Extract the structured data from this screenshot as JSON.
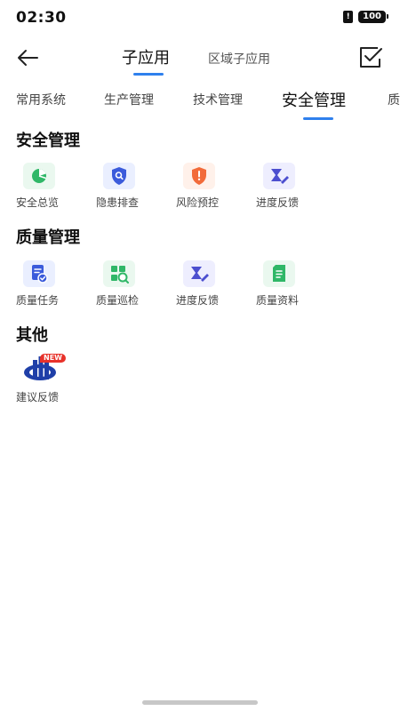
{
  "status_bar": {
    "time": "02:30",
    "sim": "!",
    "battery": "100"
  },
  "nav": {
    "tabs": [
      {
        "label": "子应用",
        "active": true
      },
      {
        "label": "区域子应用",
        "active": false
      }
    ]
  },
  "categories": [
    {
      "label": "常用系统",
      "active": false
    },
    {
      "label": "生产管理",
      "active": false
    },
    {
      "label": "技术管理",
      "active": false
    },
    {
      "label": "安全管理",
      "active": true
    },
    {
      "label": "质",
      "active": false
    }
  ],
  "sections": [
    {
      "title": "安全管理",
      "items": [
        {
          "label": "安全总览",
          "icon": "pie-chart-icon",
          "bg": "#eaf8ef",
          "color": "#2fb767"
        },
        {
          "label": "隐患排查",
          "icon": "shield-search-icon",
          "bg": "#eaefff",
          "color": "#3b5bdb"
        },
        {
          "label": "风险预控",
          "icon": "shield-alert-icon",
          "bg": "#fff1ea",
          "color": "#f26b3a"
        },
        {
          "label": "进度反馈",
          "icon": "hourglass-edit-icon",
          "bg": "#eeeefe",
          "color": "#4c4fcf"
        }
      ]
    },
    {
      "title": "质量管理",
      "items": [
        {
          "label": "质量任务",
          "icon": "task-check-icon",
          "bg": "#eaefff",
          "color": "#3b5bdb"
        },
        {
          "label": "质量巡检",
          "icon": "inspection-icon",
          "bg": "#eaf8ef",
          "color": "#2fb767"
        },
        {
          "label": "进度反馈",
          "icon": "hourglass-edit-icon",
          "bg": "#eeeefe",
          "color": "#4c4fcf"
        },
        {
          "label": "质量资料",
          "icon": "document-icon",
          "bg": "#eaf8ef",
          "color": "#2fb767"
        }
      ]
    },
    {
      "title": "其他",
      "items": [
        {
          "label": "建议反馈",
          "icon": "company-logo-icon",
          "badge": "NEW",
          "bg": "#ffffff",
          "color": "#1f3fa8"
        }
      ]
    }
  ]
}
